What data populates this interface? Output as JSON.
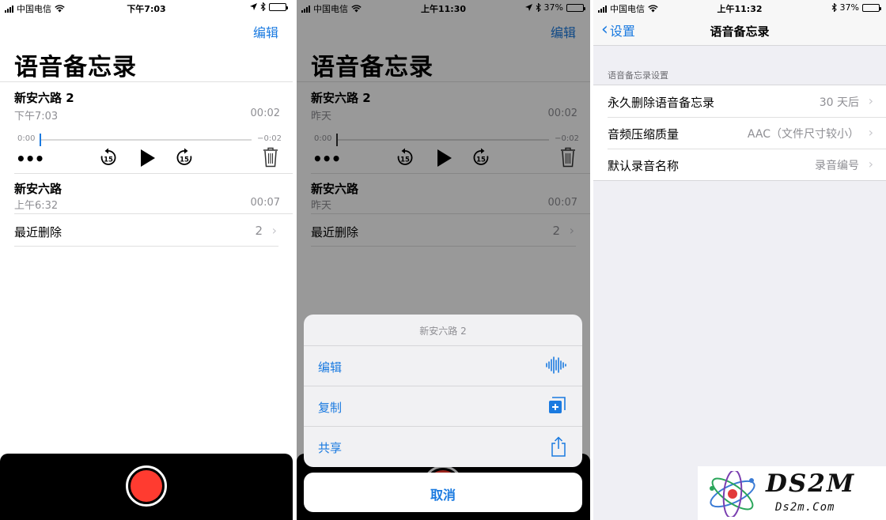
{
  "panel1": {
    "status": {
      "carrier": "中国电信",
      "time": "下午7:03"
    },
    "edit_label": "编辑",
    "title": "语音备忘录",
    "memos": [
      {
        "name": "新安六路 2",
        "time": "下午7:03",
        "duration": "00:02"
      },
      {
        "name": "新安六路",
        "time": "上午6:32",
        "duration": "00:07"
      }
    ],
    "scrubber": {
      "elapsed": "0:00",
      "remaining": "−0:02",
      "progress": 0.0
    },
    "skip_seconds": "15",
    "recently_deleted": {
      "label": "最近删除",
      "count": "2"
    }
  },
  "panel2": {
    "status": {
      "carrier": "中国电信",
      "time": "上午11:30",
      "battery": "37%"
    },
    "edit_label": "编辑",
    "title": "语音备忘录",
    "memos": [
      {
        "name": "新安六路 2",
        "time": "昨天",
        "duration": "00:02"
      },
      {
        "name": "新安六路",
        "time": "昨天",
        "duration": "00:07"
      }
    ],
    "scrubber": {
      "elapsed": "0:00",
      "remaining": "−0:02"
    },
    "skip_seconds": "15",
    "recently_deleted": {
      "label": "最近删除",
      "count": "2"
    },
    "sheet": {
      "title": "新安六路 2",
      "items": [
        {
          "label": "编辑",
          "icon": "waveform-icon"
        },
        {
          "label": "复制",
          "icon": "duplicate-icon"
        },
        {
          "label": "共享",
          "icon": "share-icon"
        }
      ],
      "cancel_label": "取消"
    }
  },
  "panel3": {
    "status": {
      "carrier": "中国电信",
      "time": "上午11:32",
      "battery": "37%"
    },
    "back_label": "设置",
    "nav_title": "语音备忘录",
    "section_header": "语音备忘录设置",
    "rows": [
      {
        "label": "永久删除语音备忘录",
        "value": "30 天后"
      },
      {
        "label": "音频压缩质量",
        "value": "AAC（文件尺寸较小）"
      },
      {
        "label": "默认录音名称",
        "value": "录音编号"
      }
    ]
  },
  "watermark": {
    "brand": "DS2M",
    "domain": "Ds2m.Com"
  },
  "colors": {
    "accent": "#1a7ae0",
    "record": "#ff3b30",
    "secondary_text": "#8e8e93",
    "battery_low": "#f5c518"
  }
}
